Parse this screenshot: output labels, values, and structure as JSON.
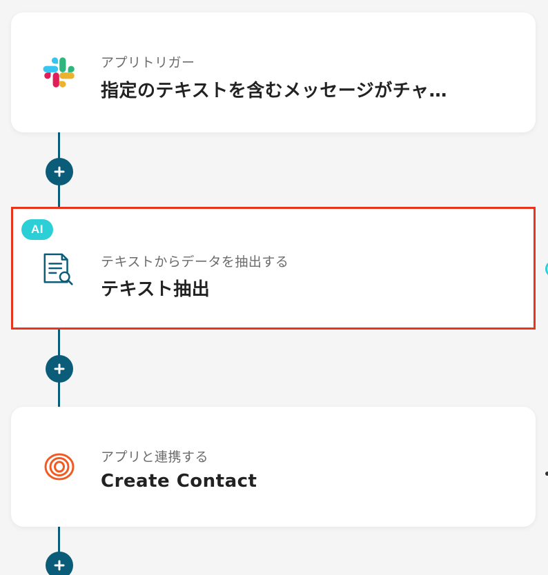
{
  "steps": [
    {
      "type_label": "アプリトリガー",
      "title": "指定のテキストを含むメッセージがチャ…",
      "icon": "slack-logo-icon",
      "badge": ""
    },
    {
      "type_label": "テキストからデータを抽出する",
      "title": "テキスト抽出",
      "icon": "document-search-icon",
      "badge": "AI",
      "selected": true
    },
    {
      "type_label": "アプリと連携する",
      "title": "Create Contact",
      "icon": "loop-rings-logo-icon",
      "badge": ""
    }
  ],
  "colors": {
    "connector": "#0b5c78",
    "selection_border": "#e8341c",
    "ai_badge": "#2ccfd6",
    "card_bg": "#ffffff",
    "page_bg": "#f5f5f5"
  }
}
